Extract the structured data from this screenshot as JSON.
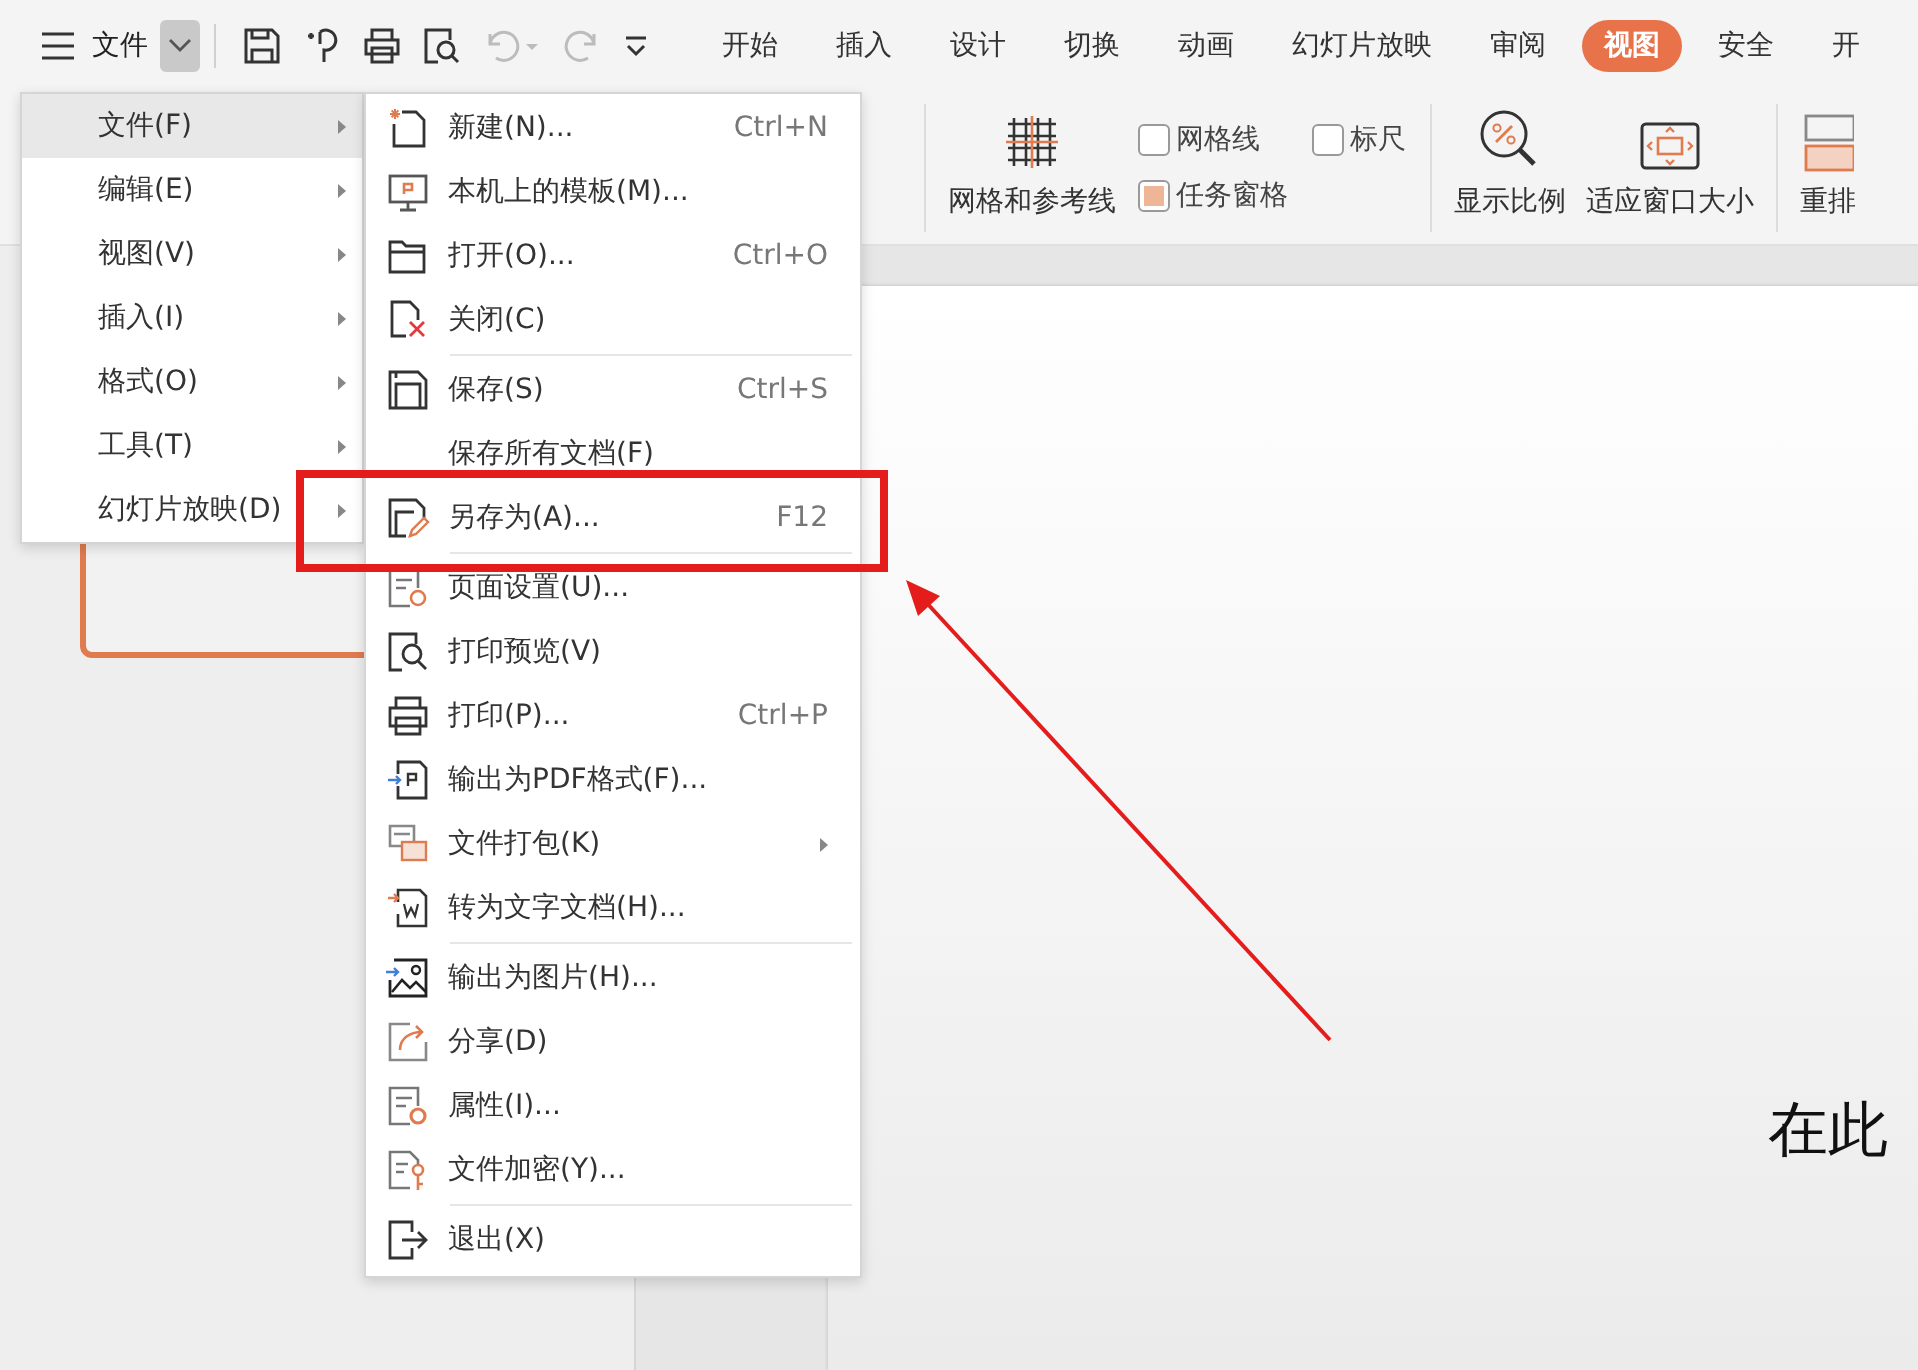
{
  "toolbar": {
    "file_label": "文件",
    "quick_actions": [
      {
        "kind": "save",
        "disabled": false
      },
      {
        "kind": "painter",
        "disabled": false
      },
      {
        "kind": "print",
        "disabled": false
      },
      {
        "kind": "preview",
        "disabled": false
      },
      {
        "kind": "undo",
        "disabled": true
      },
      {
        "kind": "redo",
        "disabled": true
      },
      {
        "kind": "customize",
        "disabled": false
      }
    ]
  },
  "tabs": [
    {
      "label": "开始",
      "selected": false
    },
    {
      "label": "插入",
      "selected": false
    },
    {
      "label": "设计",
      "selected": false
    },
    {
      "label": "切换",
      "selected": false
    },
    {
      "label": "动画",
      "selected": false
    },
    {
      "label": "幻灯片放映",
      "selected": false
    },
    {
      "label": "审阅",
      "selected": false
    },
    {
      "label": "视图",
      "selected": true
    },
    {
      "label": "安全",
      "selected": false
    },
    {
      "label": "开",
      "selected": false
    }
  ],
  "ribbon": {
    "grid_button": "网格和参考线",
    "checkboxes": [
      {
        "label": "网格线",
        "checked": false
      },
      {
        "label": "任务窗格",
        "checked": true
      },
      {
        "label": "标尺",
        "checked": false
      }
    ],
    "buttons": [
      {
        "label": "显示比例",
        "kind": "zoom"
      },
      {
        "label": "适应窗口大小",
        "kind": "fit"
      },
      {
        "label": "重排",
        "kind": "arrange"
      }
    ]
  },
  "slide": {
    "subtitle": "在此"
  },
  "main_menu": [
    {
      "label": "文件(F)",
      "selected": true
    },
    {
      "label": "编辑(E)",
      "selected": false
    },
    {
      "label": "视图(V)",
      "selected": false
    },
    {
      "label": "插入(I)",
      "selected": false
    },
    {
      "label": "格式(O)",
      "selected": false
    },
    {
      "label": "工具(T)",
      "selected": false
    },
    {
      "label": "幻灯片放映(D)",
      "selected": false
    }
  ],
  "file_menu": [
    {
      "label": "新建(N)...",
      "shortcut": "Ctrl+N"
    },
    {
      "label": "本机上的模板(M)..."
    },
    {
      "label": "打开(O)...",
      "shortcut": "Ctrl+O"
    },
    {
      "label": "关闭(C)"
    },
    {
      "label": "保存(S)",
      "shortcut": "Ctrl+S",
      "divider_before": true
    },
    {
      "label": "保存所有文档(F)"
    },
    {
      "label": "另存为(A)...",
      "shortcut": "F12"
    },
    {
      "label": "页面设置(U)...",
      "divider_before": true
    },
    {
      "label": "打印预览(V)"
    },
    {
      "label": "打印(P)...",
      "shortcut": "Ctrl+P"
    },
    {
      "label": "输出为PDF格式(F)..."
    },
    {
      "label": "文件打包(K)",
      "submenu": true
    },
    {
      "label": "转为文字文档(H)..."
    },
    {
      "label": "输出为图片(H)...",
      "divider_before": true
    },
    {
      "label": "分享(D)"
    },
    {
      "label": "属性(I)..."
    },
    {
      "label": "文件加密(Y)..."
    },
    {
      "label": "退出(X)",
      "divider_before": true
    }
  ]
}
